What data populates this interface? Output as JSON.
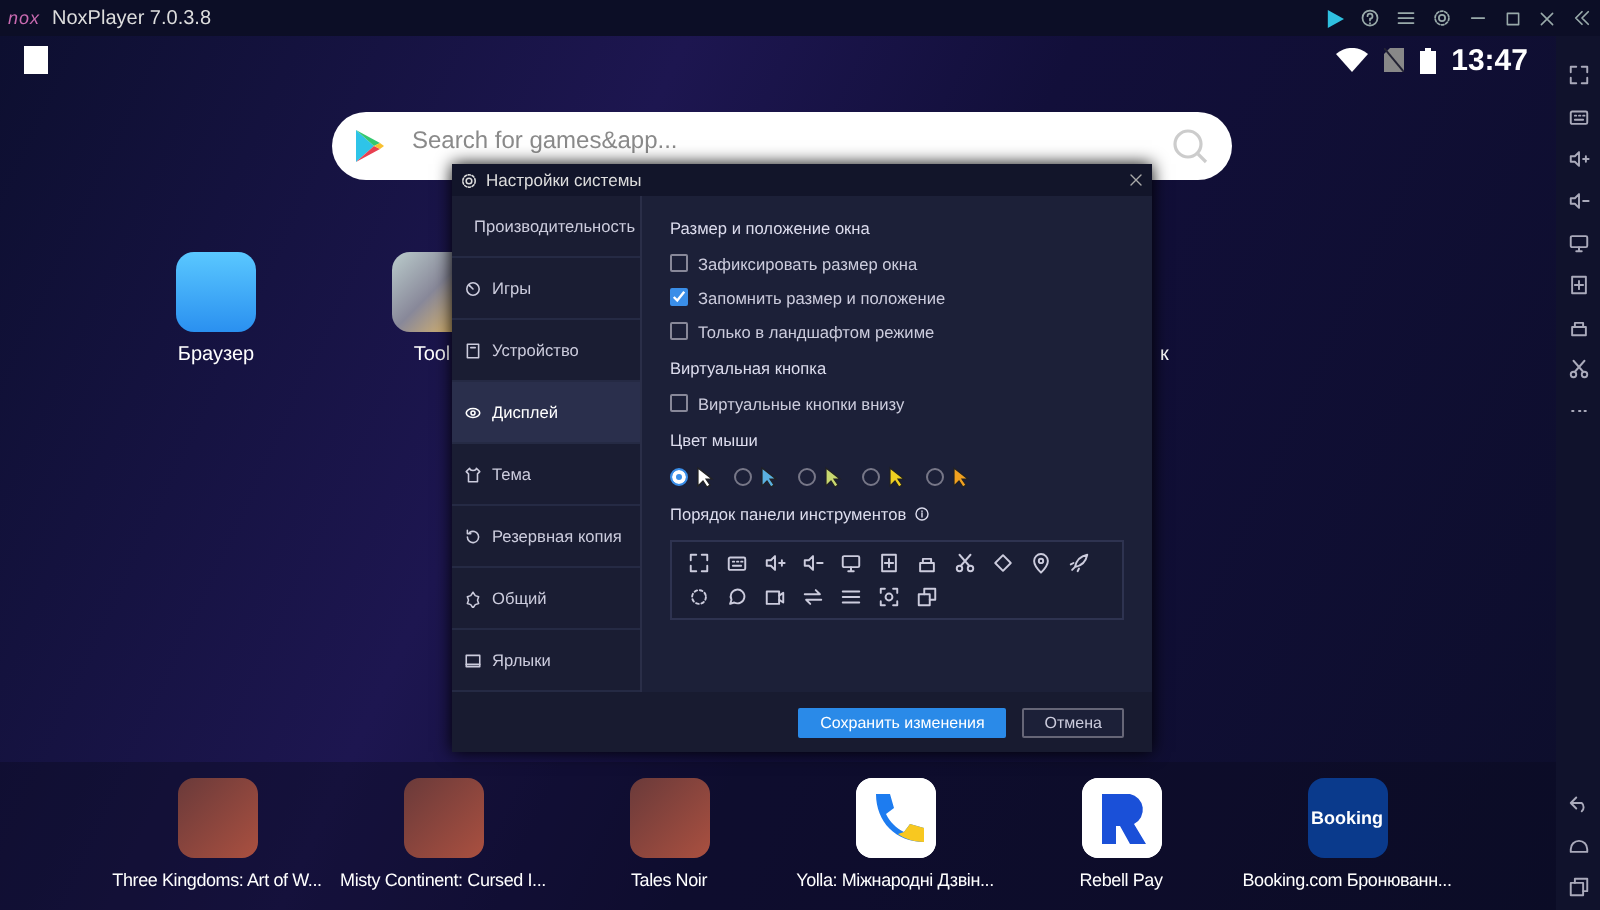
{
  "window": {
    "logo": "nox",
    "title": "NoxPlayer 7.0.3.8"
  },
  "status_bar": {
    "time": "13:47"
  },
  "search": {
    "placeholder": "Search for games&app..."
  },
  "desktop_apps": [
    {
      "label": "Браузер",
      "kind": "browser"
    },
    {
      "label": "Tool",
      "kind": "tools"
    },
    {
      "label": "к",
      "kind": "hidden"
    }
  ],
  "dialog": {
    "title": "Настройки системы",
    "sidebar": [
      {
        "label": "Производительность",
        "selected": false
      },
      {
        "label": "Игры",
        "selected": false
      },
      {
        "label": "Устройство",
        "selected": false
      },
      {
        "label": "Дисплей",
        "selected": true
      },
      {
        "label": "Тема",
        "selected": false
      },
      {
        "label": "Резервная копия",
        "selected": false
      },
      {
        "label": "Общий",
        "selected": false
      },
      {
        "label": "Ярлыки",
        "selected": false
      }
    ],
    "sections": [
      {
        "kind": "checkboxes",
        "title": "Размер и положение окна",
        "options": [
          {
            "label": "Зафиксировать размер окна",
            "checked": false
          },
          {
            "label": "Запомнить размер и положение",
            "checked": true
          },
          {
            "label": "Только в ландшафтом режиме",
            "checked": false
          }
        ]
      },
      {
        "kind": "checkboxes",
        "title": "Виртуальная кнопка",
        "options": [
          {
            "label": "Виртуальные кнопки внизу",
            "checked": false
          }
        ]
      },
      {
        "kind": "cursor_colors",
        "title": "Цвет мыши",
        "options": [
          {
            "color": "#ffffff",
            "selected": true
          },
          {
            "color": "#5ab0e0",
            "selected": false
          },
          {
            "color": "#c8d870",
            "selected": false
          },
          {
            "color": "#f0d020",
            "selected": false
          },
          {
            "color": "#f0a020",
            "selected": false
          }
        ]
      },
      {
        "kind": "toolbar_order",
        "title": "Порядок панели инструментов"
      }
    ],
    "buttons": [
      {
        "label": "Сохранить изменения",
        "kind": "primary"
      },
      {
        "label": "Отмена",
        "kind": "secondary"
      }
    ]
  },
  "dock": [
    {
      "label": "Three Kingdoms: Art of W...",
      "kind": "photo"
    },
    {
      "label": "Misty Continent: Cursed I...",
      "kind": "photo"
    },
    {
      "label": "Tales Noir",
      "kind": "photo"
    },
    {
      "label": "Yolla: Міжнародні Дзвін...",
      "kind": "yolla"
    },
    {
      "label": "Rebell Pay",
      "kind": "rebell"
    },
    {
      "label": "Booking.com Бронюванн...",
      "kind": "booking",
      "logo_text": "Booking"
    }
  ]
}
